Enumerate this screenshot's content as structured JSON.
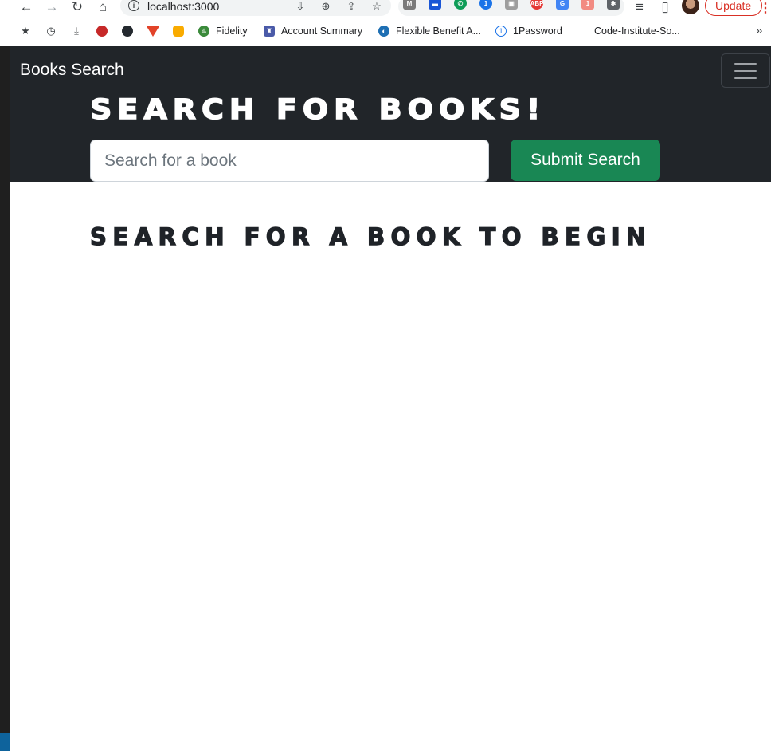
{
  "browser": {
    "url": "localhost:3000",
    "update_label": "Update",
    "bookmarks": [
      {
        "label": "Fidelity",
        "icon": "fidelity-icon"
      },
      {
        "label": "Account Summary",
        "icon": "account-summary-icon"
      },
      {
        "label": "Flexible Benefit A...",
        "icon": "flexible-benefit-icon"
      },
      {
        "label": "1Password",
        "icon": "1password-icon"
      },
      {
        "label": "Code-Institute-So...",
        "icon": "code-institute-icon"
      }
    ],
    "more_bookmarks": "»"
  },
  "app": {
    "brand": "Books Search",
    "hero_title": "Search for Books!",
    "search_placeholder": "Search for a book",
    "submit_label": "Submit Search",
    "empty_state": "Search for a book to begin"
  },
  "colors": {
    "navbar_bg": "#212529",
    "submit_bg": "#198754",
    "update_red": "#d93025"
  }
}
